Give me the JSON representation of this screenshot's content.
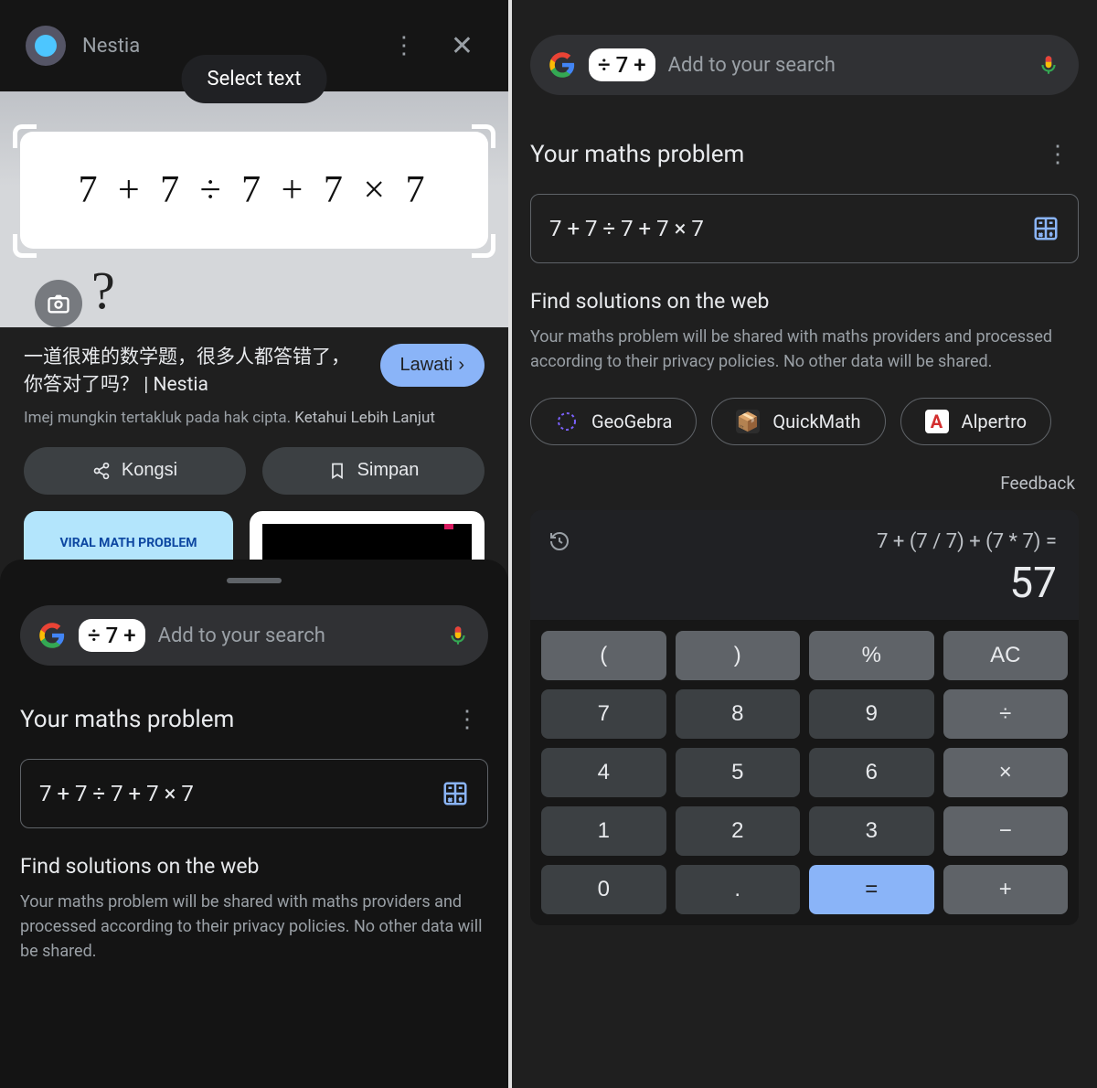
{
  "left": {
    "header": {
      "title": "Nestia"
    },
    "toast": "Select text",
    "image_equation": "7 + 7 ÷ 7 + 7 × 7",
    "result": {
      "title": "一道很难的数学题，很多人都答错了，你答对了吗？ | Nestia",
      "visit": "Lawati",
      "caption": "Imej mungkin tertakluk pada hak cipta.",
      "learn_more": "Ketahui Lebih Lanjut"
    },
    "actions": {
      "share": "Kongsi",
      "save": "Simpan"
    },
    "thumb_label": "VIRAL MATH PROBLEM",
    "search": {
      "chip": "÷ 7 +",
      "placeholder": "Add to your search"
    },
    "maths_heading": "Your maths problem",
    "expression": "7 + 7 ÷ 7 + 7 × 7",
    "find_heading": "Find solutions on the web",
    "disclaimer": "Your maths problem will be shared with maths providers and processed according to their privacy policies. No other data will be shared."
  },
  "right": {
    "search": {
      "chip": "÷ 7 +",
      "placeholder": "Add to your search"
    },
    "maths_heading": "Your maths problem",
    "expression": "7 + 7 ÷ 7 + 7 × 7",
    "find_heading": "Find solutions on the web",
    "disclaimer": "Your maths problem will be shared with maths providers and processed according to their privacy policies. No other data will be shared.",
    "providers": [
      "GeoGebra",
      "QuickMath",
      "Alpertro"
    ],
    "feedback": "Feedback",
    "calc": {
      "line1": "7 + (7 / 7) + (7 * 7) =",
      "result": "57",
      "keys": [
        {
          "l": "(",
          "c": "light"
        },
        {
          "l": ")",
          "c": "light"
        },
        {
          "l": "%",
          "c": "light"
        },
        {
          "l": "AC",
          "c": "light"
        },
        {
          "l": "7",
          "c": "op"
        },
        {
          "l": "8",
          "c": "op"
        },
        {
          "l": "9",
          "c": "op"
        },
        {
          "l": "÷",
          "c": "light"
        },
        {
          "l": "4",
          "c": "op"
        },
        {
          "l": "5",
          "c": "op"
        },
        {
          "l": "6",
          "c": "op"
        },
        {
          "l": "×",
          "c": "light"
        },
        {
          "l": "1",
          "c": "op"
        },
        {
          "l": "2",
          "c": "op"
        },
        {
          "l": "3",
          "c": "op"
        },
        {
          "l": "−",
          "c": "light"
        },
        {
          "l": "0",
          "c": "op"
        },
        {
          "l": ".",
          "c": "op"
        },
        {
          "l": "=",
          "c": "eq"
        },
        {
          "l": "+",
          "c": "light"
        }
      ]
    }
  }
}
